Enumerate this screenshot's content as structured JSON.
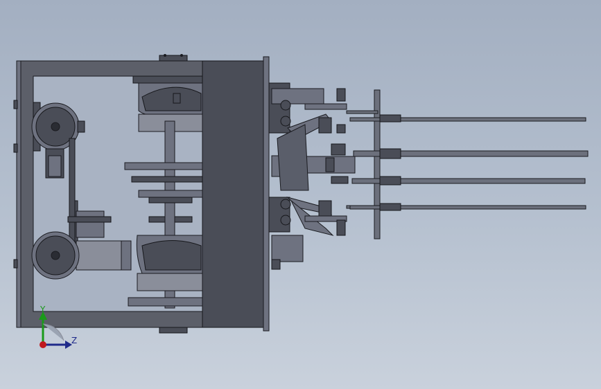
{
  "view": {
    "background_top": "#a3afc1",
    "background_bottom": "#c9d1dc",
    "part_color": "#5c5f69",
    "edge_color": "#1a1b20"
  },
  "triad": {
    "y_label": "Y",
    "z_label": "Z",
    "y_color": "#1a9a1a",
    "z_color": "#1f2a8a",
    "origin_color": "#c0191e"
  }
}
